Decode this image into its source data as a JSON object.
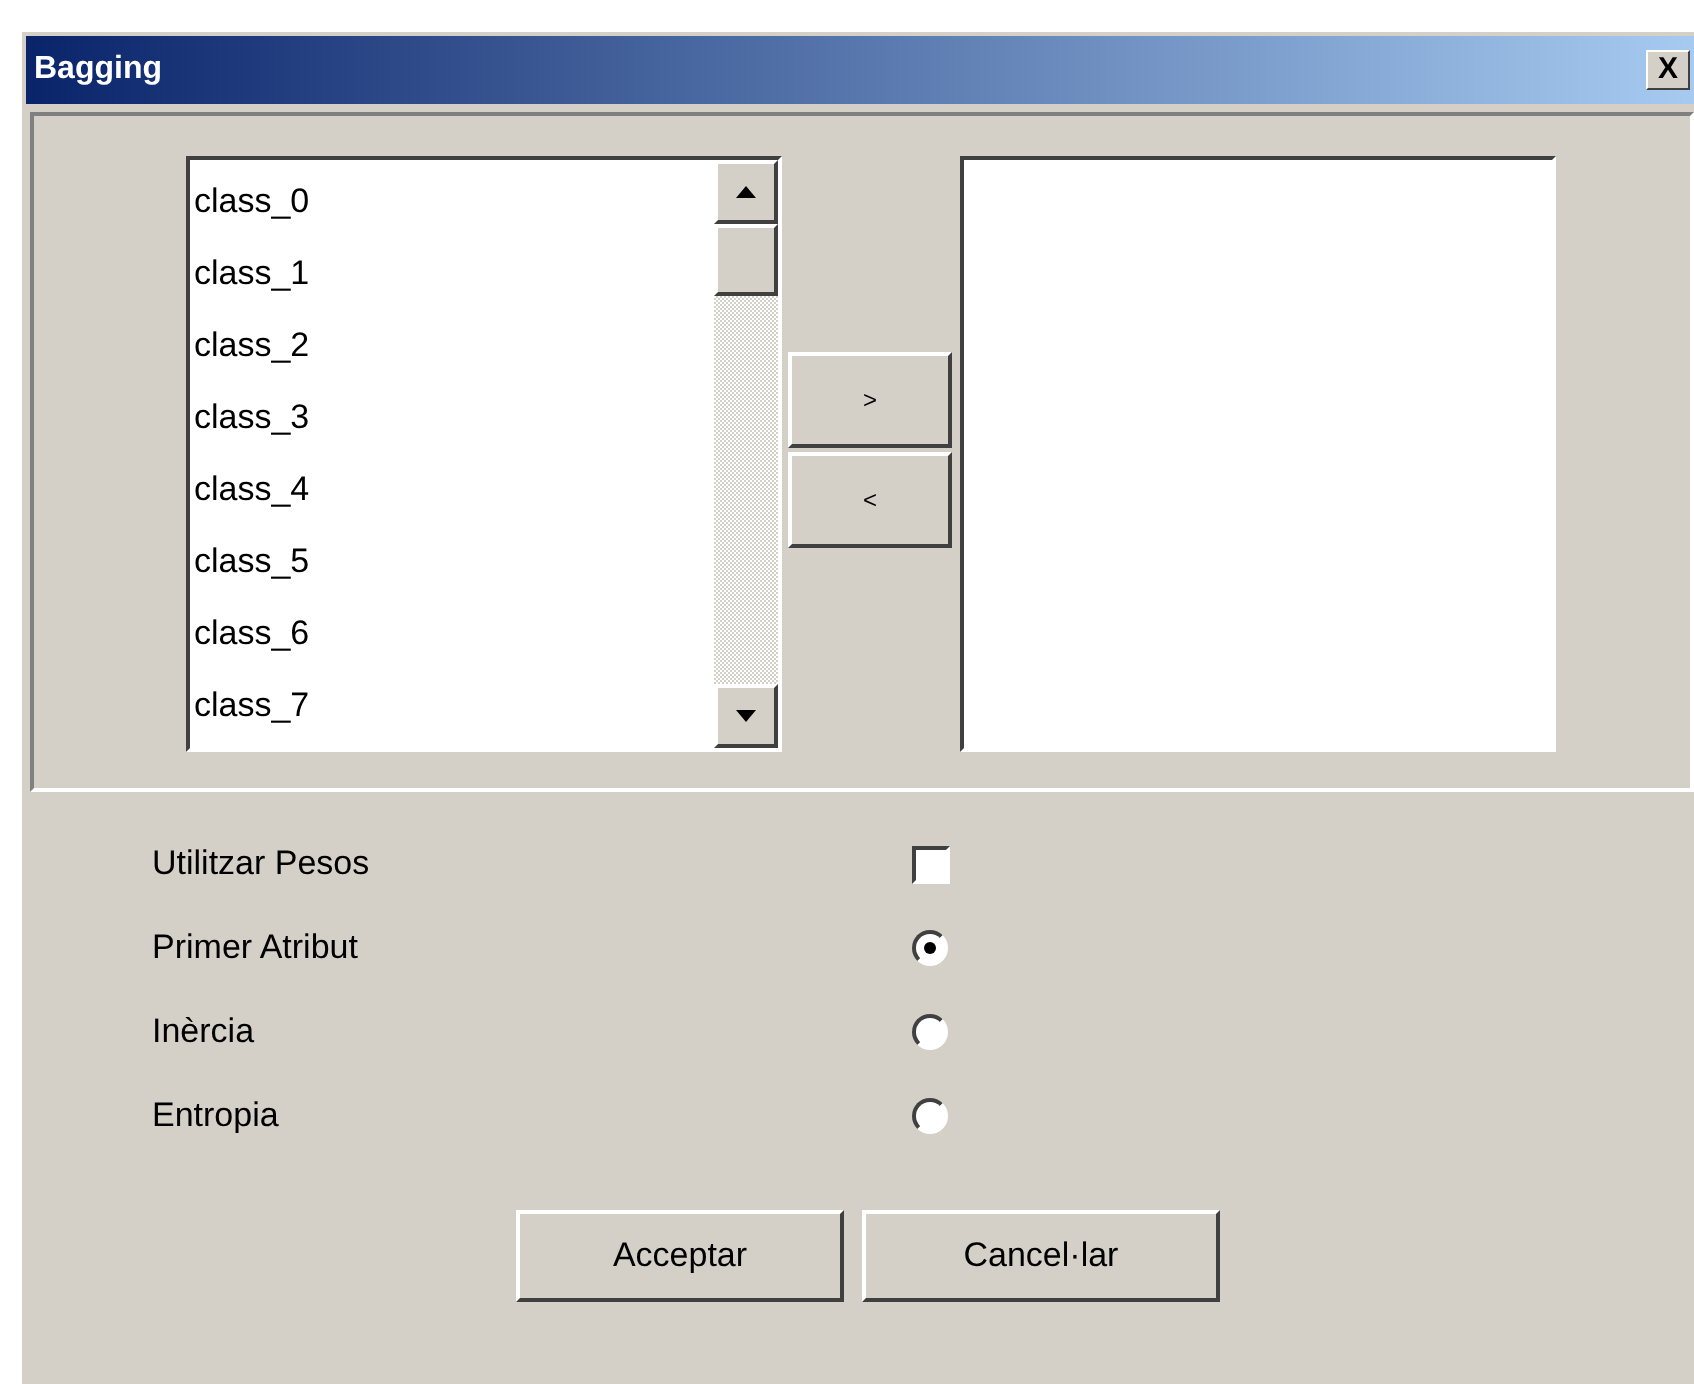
{
  "window": {
    "title": "Bagging",
    "close": "X"
  },
  "available_list": {
    "items": [
      "class_0",
      "class_1",
      "class_2",
      "class_3",
      "class_4",
      "class_5",
      "class_6",
      "class_7"
    ]
  },
  "move_buttons": [
    ">",
    "<"
  ],
  "options": [
    {
      "kind": "checkbox",
      "label": "Utilitzar Pesos",
      "checked": false
    },
    {
      "kind": "radio",
      "label": "Primer Atribut",
      "selected": true
    },
    {
      "kind": "radio",
      "label": "Inèrcia",
      "selected": false
    },
    {
      "kind": "radio",
      "label": "Entropia",
      "selected": false
    }
  ],
  "buttons": [
    "Acceptar",
    "Cancel·lar"
  ]
}
